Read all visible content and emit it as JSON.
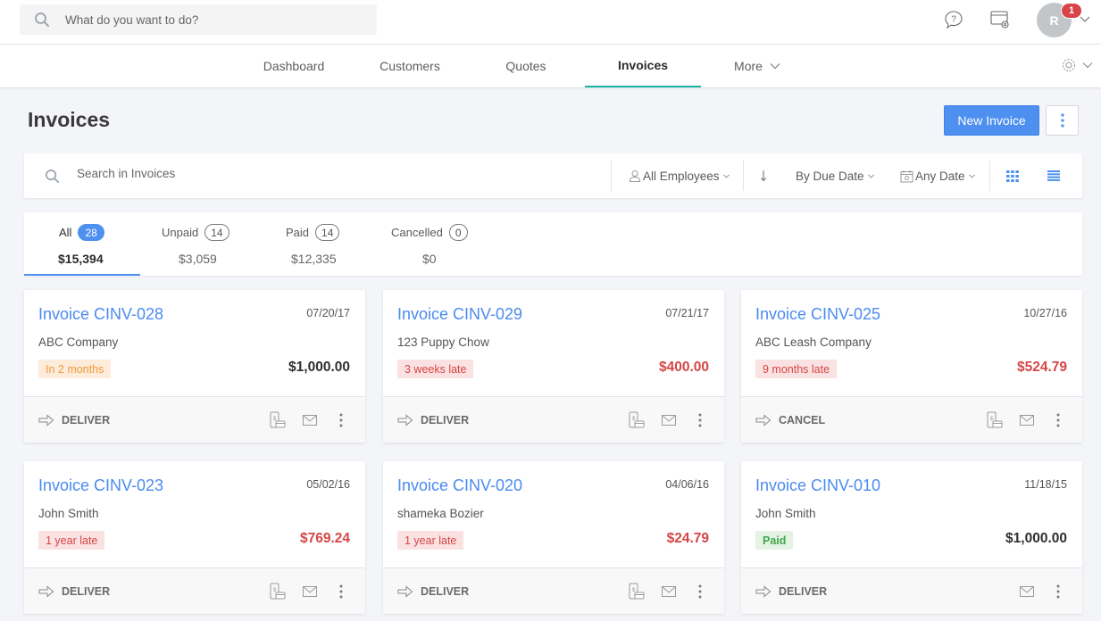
{
  "topbar": {
    "search_placeholder": "What do you want to do?",
    "icons": [
      "search-icon",
      "help-chat-icon",
      "window-settings-icon",
      "chevron-down-icon"
    ],
    "avatar_initial": "R",
    "notification_count": "1"
  },
  "nav": {
    "items": [
      {
        "label": "Dashboard",
        "active": false
      },
      {
        "label": "Customers",
        "active": false
      },
      {
        "label": "Quotes",
        "active": false
      },
      {
        "label": "Invoices",
        "active": true
      },
      {
        "label": "More",
        "active": false
      }
    ],
    "active_color": "#1ab5a5"
  },
  "page": {
    "title": "Invoices",
    "new_button": "New Invoice",
    "accent": "#4d90f0"
  },
  "filters": {
    "search_placeholder": "Search in Invoices",
    "employees": "All Employees",
    "sort_direction_icon": "arrow-down-icon",
    "sort_by": "By Due Date",
    "date_range": "Any Date",
    "view_modes": [
      "grid-view",
      "list-view"
    ]
  },
  "tabs": [
    {
      "label": "All",
      "count": "28",
      "amount": "$15,394",
      "active": true
    },
    {
      "label": "Unpaid",
      "count": "14",
      "amount": "$3,059",
      "active": false
    },
    {
      "label": "Paid",
      "count": "14",
      "amount": "$12,335",
      "active": false
    },
    {
      "label": "Cancelled",
      "count": "0",
      "amount": "$0",
      "active": false
    }
  ],
  "invoices": [
    {
      "title": "Invoice CINV-028",
      "date": "07/20/17",
      "customer": "ABC Company",
      "status": "In 2 months",
      "status_type": "upcoming",
      "amount": "$1,000.00",
      "overdue": false,
      "action": "DELIVER",
      "has_payment_icon": true
    },
    {
      "title": "Invoice CINV-029",
      "date": "07/21/17",
      "customer": "123 Puppy Chow",
      "status": "3 weeks late",
      "status_type": "late",
      "amount": "$400.00",
      "overdue": true,
      "action": "DELIVER",
      "has_payment_icon": true
    },
    {
      "title": "Invoice CINV-025",
      "date": "10/27/16",
      "customer": "ABC Leash Company",
      "status": "9 months late",
      "status_type": "late",
      "amount": "$524.79",
      "overdue": true,
      "action": "CANCEL",
      "has_payment_icon": true
    },
    {
      "title": "Invoice CINV-023",
      "date": "05/02/16",
      "customer": "John Smith",
      "status": "1 year late",
      "status_type": "late",
      "amount": "$769.24",
      "overdue": true,
      "action": "DELIVER",
      "has_payment_icon": true
    },
    {
      "title": "Invoice CINV-020",
      "date": "04/06/16",
      "customer": "shameka Bozier",
      "status": "1 year late",
      "status_type": "late",
      "amount": "$24.79",
      "overdue": true,
      "action": "DELIVER",
      "has_payment_icon": true
    },
    {
      "title": "Invoice CINV-010",
      "date": "11/18/15",
      "customer": "John Smith",
      "status": "Paid",
      "status_type": "paid",
      "amount": "$1,000.00",
      "overdue": false,
      "action": "DELIVER",
      "has_payment_icon": false
    }
  ]
}
